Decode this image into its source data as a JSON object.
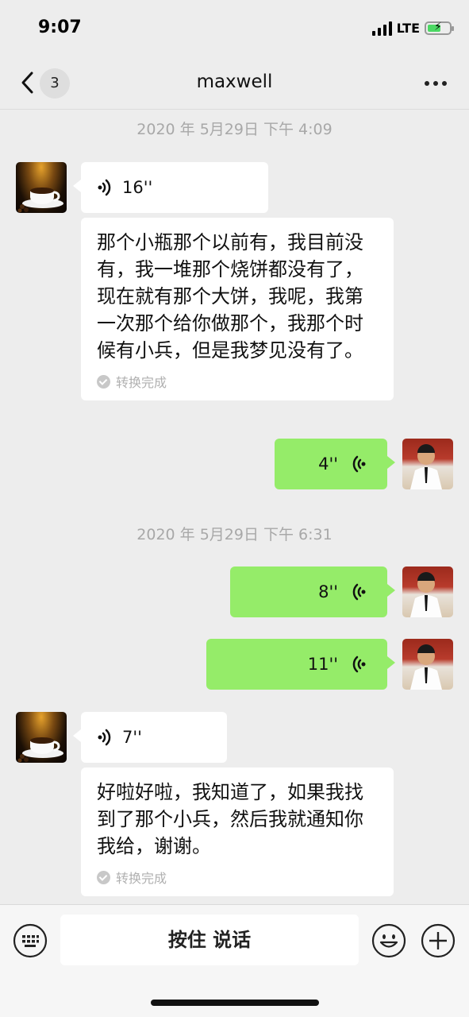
{
  "status_bar": {
    "time": "9:07",
    "network": "LTE",
    "battery_charge": 0.6,
    "battery_color": "#4cd964"
  },
  "nav": {
    "back_icon": "chevron-left-icon",
    "unread_count": "3",
    "title": "maxwell",
    "more_icon": "ellipsis-icon"
  },
  "messages": {
    "ts1": "2020 年 5月29日 下午 4:09",
    "m1_duration": "16''",
    "m1_transcript": "那个小瓶那个以前有，我目前没有，我一堆那个烧饼都没有了，现在就有那个大饼，我呢，我第一次那个给你做那个，我那个时候有小兵，但是我梦见没有了。",
    "m1_status": "转换完成",
    "m2_duration": "4''",
    "ts2": "2020 年 5月29日 下午 6:31",
    "m3_duration": "8''",
    "m4_duration": "11''",
    "m5_duration": "7''",
    "m5_transcript": "好啦好啦，我知道了，如果我找到了那个小兵，然后我就通知你我给，谢谢。",
    "m5_status": "转换完成"
  },
  "bottom_bar": {
    "keyboard_icon": "keyboard-icon",
    "hold_to_talk": "按住 说话",
    "emoji_icon": "smiley-icon",
    "plus_icon": "plus-circle-icon"
  },
  "colors": {
    "sent_bubble": "#95ec69",
    "received_bubble": "#ffffff",
    "background": "#ededed"
  }
}
